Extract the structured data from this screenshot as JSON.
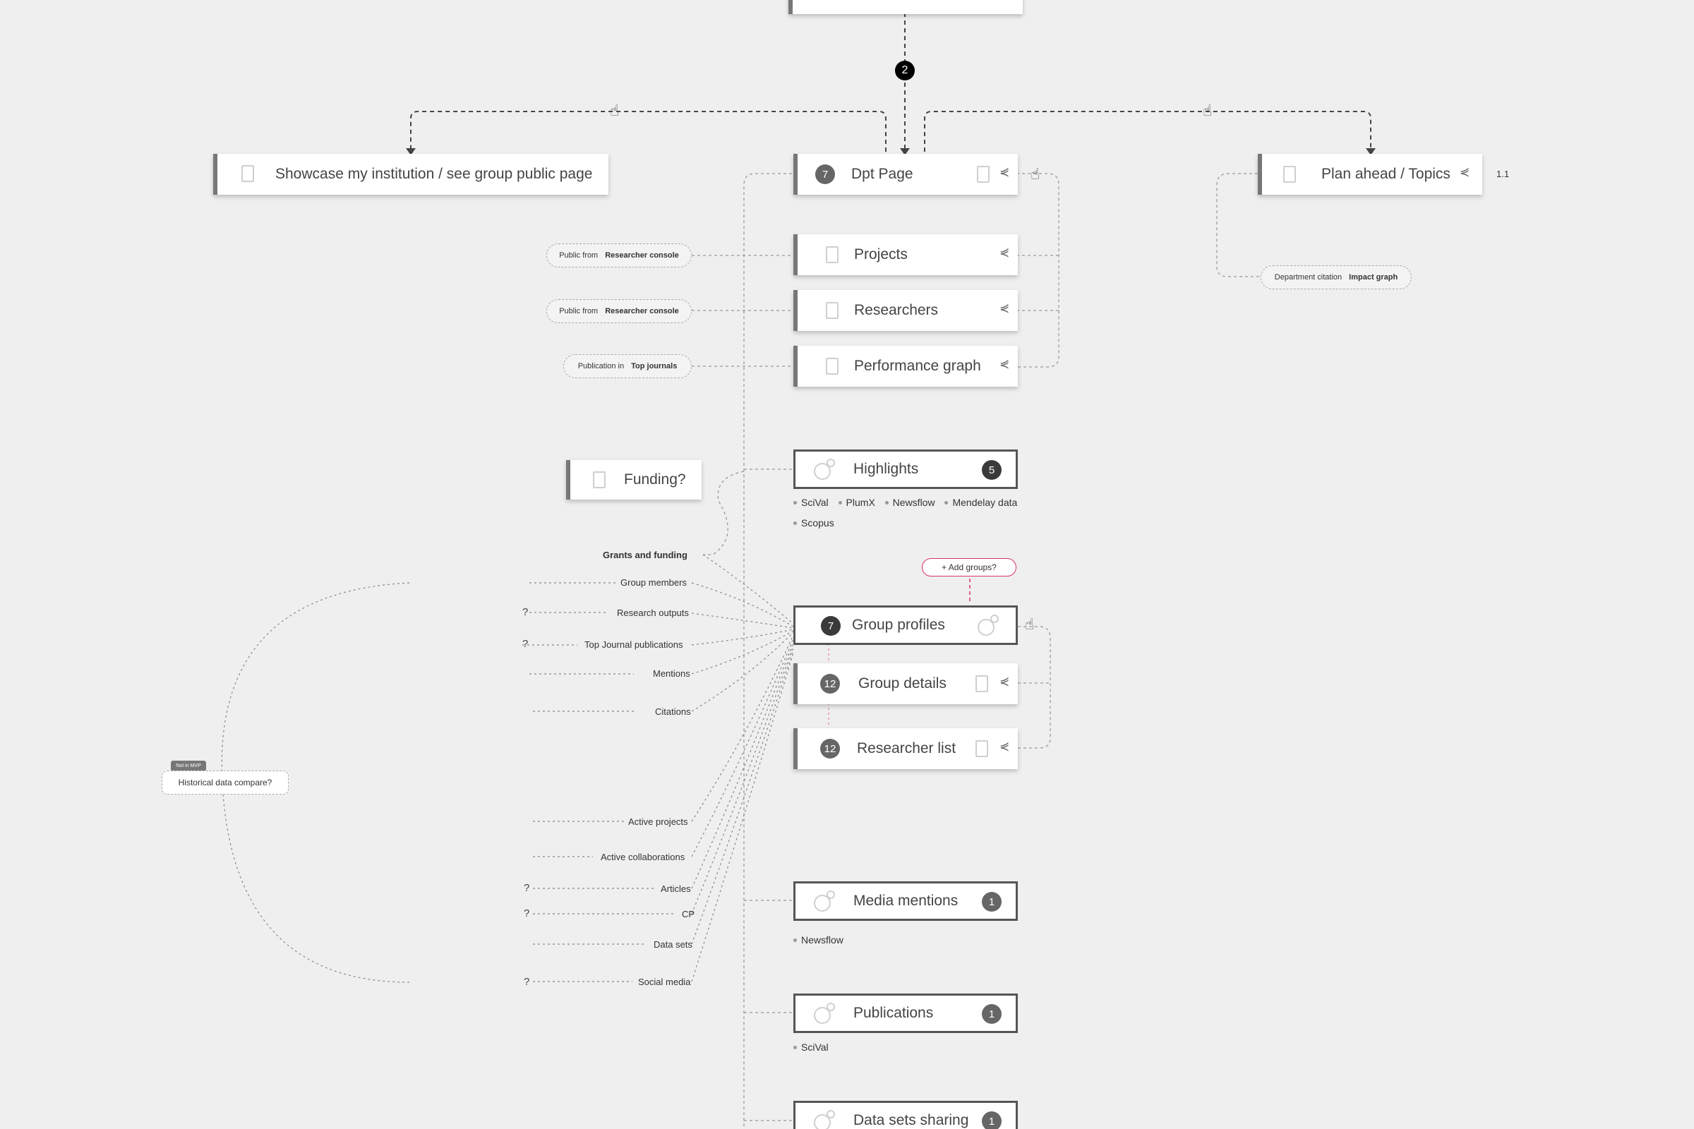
{
  "colors": {
    "background": "#efefef",
    "node": "#ffffff",
    "wire": "#555555",
    "accent": "#d6336c"
  },
  "step_number": "2",
  "top_cards": {
    "showcase": "Showcase my institution / see group public page",
    "dpt": {
      "label": "Dpt Page",
      "count": "7"
    },
    "plan": {
      "label": "Plan ahead / Topics",
      "version": "1.1"
    }
  },
  "dpt_children": [
    {
      "label": "Projects",
      "pill_prefix": "Public from",
      "pill_bold": "Researcher console"
    },
    {
      "label": "Researchers",
      "pill_prefix": "Public from",
      "pill_bold": "Researcher console"
    },
    {
      "label": "Performance graph",
      "pill_prefix": "Publication in",
      "pill_bold": "Top journals"
    }
  ],
  "plan_pill": {
    "prefix": "Department citation",
    "bold": "Impact graph"
  },
  "funding": "Funding?",
  "highlights": {
    "label": "Highlights",
    "count": "5",
    "sources": [
      "SciVal",
      "PlumX",
      "Newsflow",
      "Mendelay data",
      "Scopus"
    ]
  },
  "add_groups": "+ Add groups?",
  "group_profiles": {
    "label": "Group profiles",
    "count": "7"
  },
  "group_details": {
    "label": "Group details",
    "count": "12"
  },
  "researcher_list": {
    "label": "Researcher list",
    "count": "12"
  },
  "media_mentions": {
    "label": "Media mentions",
    "count": "1",
    "sources": [
      "Newsflow"
    ]
  },
  "publications": {
    "label": "Publications",
    "count": "1",
    "sources": [
      "SciVal"
    ]
  },
  "data_sets": {
    "label": "Data sets sharing",
    "count": "1"
  },
  "grants_label": "Grants and funding",
  "side_labels": [
    "Group members",
    "Research outputs",
    "Top Journal publications",
    "Mentions",
    "Citations",
    "Active projects",
    "Active collaborations",
    "Articles",
    "CP",
    "Data sets",
    "Social media"
  ],
  "question_mark": "?",
  "historical": {
    "tag": "Not in MVP",
    "label": "Historical data compare?"
  },
  "icons": {
    "doc": "document-icon",
    "share": "share-icon",
    "cursor": "hand-cursor-icon",
    "orbit": "orbit-icon"
  }
}
